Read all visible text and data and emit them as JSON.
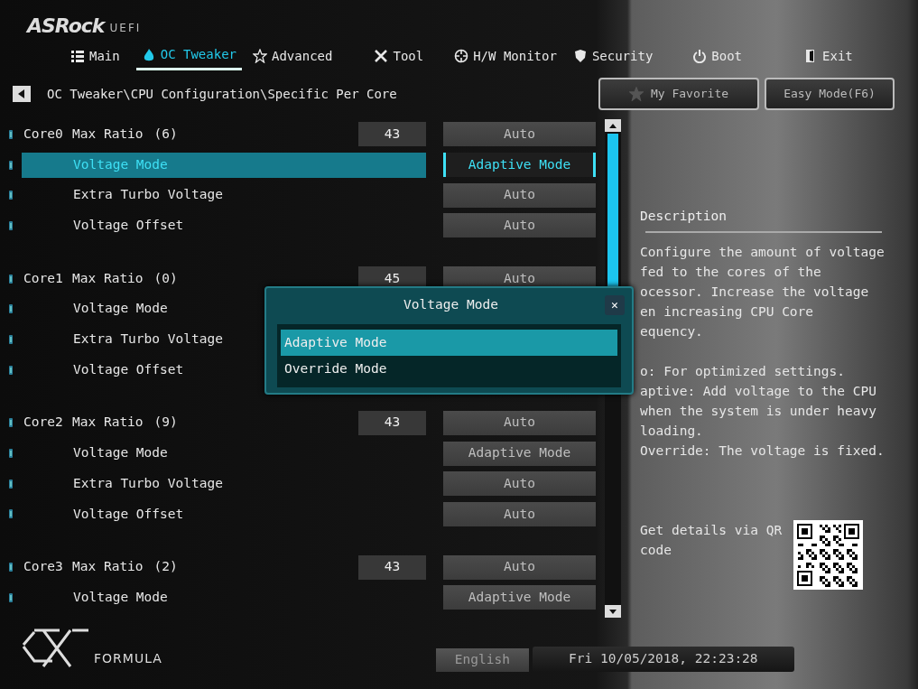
{
  "brand": {
    "name": "ASRock",
    "suffix": "UEFI"
  },
  "tabs": [
    {
      "label": "Main",
      "selected": false
    },
    {
      "label": "OC Tweaker",
      "selected": true
    },
    {
      "label": "Advanced",
      "selected": false
    },
    {
      "label": "Tool",
      "selected": false
    },
    {
      "label": "H/W Monitor",
      "selected": false
    },
    {
      "label": "Security",
      "selected": false
    },
    {
      "label": "Boot",
      "selected": false
    },
    {
      "label": "Exit",
      "selected": false
    }
  ],
  "breadcrumb": "OC Tweaker\\CPU Configuration\\Specific Per Core",
  "top_buttons": [
    {
      "label": "My Favorite"
    },
    {
      "label": "Easy Mode(F6)"
    }
  ],
  "cores": [
    {
      "name": "Core0",
      "rows": [
        {
          "label": "Max Ratio",
          "extra": "(6)",
          "number": "43",
          "value": "Auto",
          "selected": false
        },
        {
          "label": "Voltage Mode",
          "value": "Adaptive Mode",
          "selected": true
        },
        {
          "label": "Extra Turbo Voltage",
          "value": "Auto",
          "selected": false
        },
        {
          "label": "Voltage Offset",
          "value": "Auto",
          "selected": false
        }
      ]
    },
    {
      "name": "Core1",
      "rows": [
        {
          "label": "Max Ratio",
          "extra": "(0)",
          "number": "45",
          "value": "Auto",
          "selected": false
        },
        {
          "label": "Voltage Mode",
          "selected": false
        },
        {
          "label": "Extra Turbo Voltage",
          "selected": false
        },
        {
          "label": "Voltage Offset",
          "selected": false
        }
      ]
    },
    {
      "name": "Core2",
      "rows": [
        {
          "label": "Max Ratio",
          "extra": "(9)",
          "number": "43",
          "value": "Auto",
          "selected": false
        },
        {
          "label": "Voltage Mode",
          "value": "Adaptive Mode",
          "selected": false
        },
        {
          "label": "Extra Turbo Voltage",
          "value": "Auto",
          "selected": false
        },
        {
          "label": "Voltage Offset",
          "value": "Auto",
          "selected": false
        }
      ]
    },
    {
      "name": "Core3",
      "rows": [
        {
          "label": "Max Ratio",
          "extra": "(2)",
          "number": "43",
          "value": "Auto",
          "selected": false
        },
        {
          "label": "Voltage Mode",
          "value": "Adaptive Mode",
          "selected": false
        }
      ]
    }
  ],
  "dialog": {
    "title": "Voltage Mode",
    "close": "✕",
    "options": [
      {
        "label": "Adaptive Mode",
        "selected": true
      },
      {
        "label": "Override Mode",
        "selected": false
      }
    ]
  },
  "description": {
    "title": "Description",
    "paragraphs": [
      [
        "Configure the amount of voltage",
        "fed to the cores of the",
        "ocessor. Increase the voltage",
        "en increasing CPU Core",
        "equency."
      ],
      [
        "o: For optimized settings.",
        "aptive: Add voltage to the CPU",
        "when the system is under heavy",
        "loading.",
        "Override: The voltage is fixed."
      ]
    ],
    "qr_text": "Get details via QR code"
  },
  "footer": {
    "logo_text": "FORMULA",
    "language": "English",
    "datetime": "Fri 10/05/2018, 22:23:28"
  }
}
